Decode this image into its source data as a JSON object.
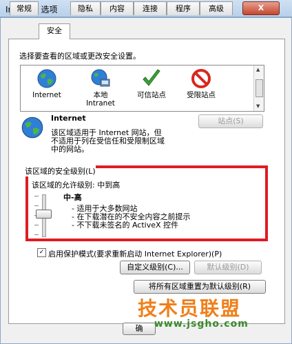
{
  "window": {
    "title": "Internet 选项",
    "close": "X"
  },
  "tabs": [
    "常规",
    "安全",
    "隐私",
    "内容",
    "连接",
    "程序",
    "高级"
  ],
  "active_tab": "安全",
  "zone_prompt": "选择要查看的区域或更改安全设置。",
  "zones": [
    {
      "label": "Internet",
      "icon": "globe-icon"
    },
    {
      "label": "本地",
      "label2": "Intranet",
      "icon": "local-intranet-icon"
    },
    {
      "label": "可信站点",
      "icon": "check-icon"
    },
    {
      "label": "受限站点",
      "icon": "restricted-icon"
    }
  ],
  "selected_zone": {
    "name": "Internet",
    "description": [
      "该区域适用于 Internet 网站，但",
      "不适用于列在受信任和受限制区域",
      "中的网站。"
    ],
    "sites_button": "站点(S)"
  },
  "security_level": {
    "group_label": "该区域的安全级别(L)",
    "allowed": "该区域的允许级别: 中到高",
    "level_name": "中-高",
    "bullets": [
      "- 适用于大多数网站",
      "- 在下载潜在的不安全内容之前提示",
      "- 不下载未签名的 ActiveX 控件"
    ],
    "slider_level": "中-高"
  },
  "protected_mode": {
    "label": "启用保护模式(要求重新启动 Internet Explorer)(P)",
    "checked": true,
    "check_mark": "✓"
  },
  "buttons": {
    "custom": "自定义级别(C)...",
    "default": "默认级别(D)",
    "reset_all": "将所有区域重置为默认级别(R)",
    "bottom_partial": "确"
  },
  "watermark": {
    "text": "技术员联盟",
    "url": "www.jsgho.com"
  },
  "colors": {
    "highlight_border": "#e01b22",
    "watermark_orange": "#ef7f1a",
    "watermark_green": "#3a8a2a"
  }
}
